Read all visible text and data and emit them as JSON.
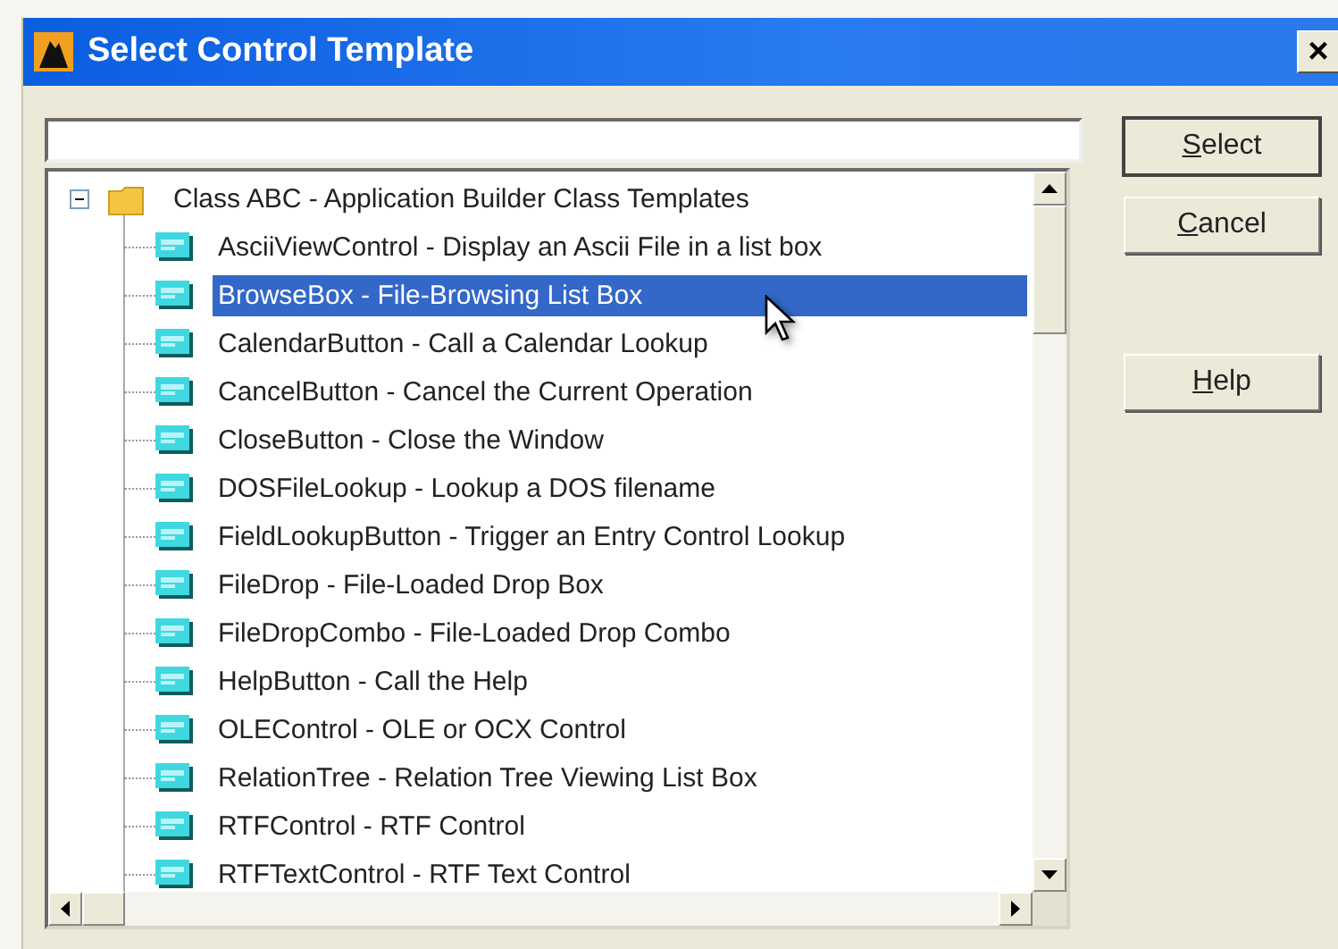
{
  "window": {
    "title": "Select Control Template",
    "close": "×"
  },
  "tree": {
    "label": "Class ABC - Application Builder Class Templates",
    "expanded": true,
    "children": [
      {
        "label": "AsciiViewControl - Display an Ascii File in a list box",
        "selected": false
      },
      {
        "label": "BrowseBox - File-Browsing List Box",
        "selected": true
      },
      {
        "label": "CalendarButton - Call a Calendar Lookup",
        "selected": false
      },
      {
        "label": "CancelButton - Cancel the Current Operation",
        "selected": false
      },
      {
        "label": "CloseButton - Close the Window",
        "selected": false
      },
      {
        "label": "DOSFileLookup - Lookup a DOS filename",
        "selected": false
      },
      {
        "label": "FieldLookupButton - Trigger an Entry Control Lookup",
        "selected": false
      },
      {
        "label": "FileDrop - File-Loaded Drop Box",
        "selected": false
      },
      {
        "label": "FileDropCombo - File-Loaded Drop Combo",
        "selected": false
      },
      {
        "label": "HelpButton - Call the Help",
        "selected": false
      },
      {
        "label": "OLEControl - OLE or OCX Control",
        "selected": false
      },
      {
        "label": "RelationTree - Relation Tree Viewing List Box",
        "selected": false
      },
      {
        "label": "RTFControl - RTF Control",
        "selected": false
      },
      {
        "label": "RTFTextControl - RTF Text Control",
        "selected": false
      }
    ]
  },
  "buttons": [
    {
      "label": "Select",
      "default": true
    },
    {
      "label": "Cancel",
      "default": false
    },
    {
      "label": "Help",
      "default": false
    }
  ]
}
